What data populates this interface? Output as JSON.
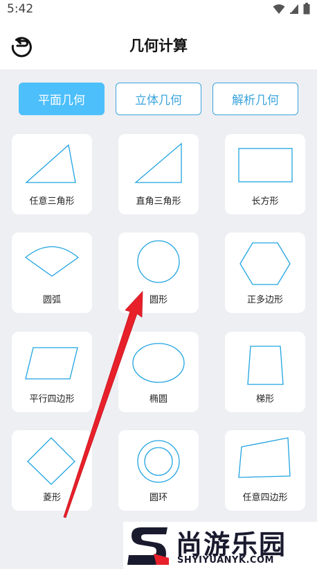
{
  "status": {
    "time": "5:42"
  },
  "header": {
    "title": "几何计算",
    "back_icon": "back-icon"
  },
  "tabs": [
    {
      "label": "平面几何",
      "active": true
    },
    {
      "label": "立体几何",
      "active": false
    },
    {
      "label": "解析几何",
      "active": false
    }
  ],
  "shapes": [
    {
      "label": "任意三角形",
      "icon": "triangle-icon"
    },
    {
      "label": "直角三角形",
      "icon": "right-triangle-icon"
    },
    {
      "label": "长方形",
      "icon": "rectangle-icon"
    },
    {
      "label": "圆弧",
      "icon": "arc-icon"
    },
    {
      "label": "圆形",
      "icon": "circle-icon"
    },
    {
      "label": "正多边形",
      "icon": "hexagon-icon"
    },
    {
      "label": "平行四边形",
      "icon": "parallelogram-icon"
    },
    {
      "label": "椭圆",
      "icon": "ellipse-icon"
    },
    {
      "label": "梯形",
      "icon": "trapezoid-icon"
    },
    {
      "label": "菱形",
      "icon": "rhombus-icon"
    },
    {
      "label": "圆环",
      "icon": "ring-icon"
    },
    {
      "label": "任意四边形",
      "icon": "quadrilateral-icon"
    }
  ],
  "watermark": {
    "title": "尚游乐园",
    "subtitle": "SHYIYUANYK.COM"
  },
  "colors": {
    "accent": "#4dbffb",
    "shape_stroke": "#1fa3e0",
    "arrow": "#e8202a"
  }
}
